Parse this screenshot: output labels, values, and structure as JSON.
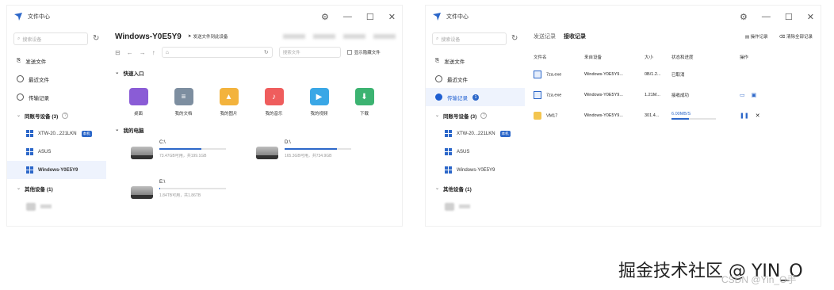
{
  "window1": {
    "title": "文件中心",
    "search_placeholder": "搜索设备",
    "nav": [
      {
        "label": "发送文件"
      },
      {
        "label": "最近文件"
      },
      {
        "label": "传输记录"
      }
    ],
    "group_same": {
      "label": "同账号设备 (3)"
    },
    "devices": [
      {
        "label": "XTW-20...221LKN",
        "tag": "本机"
      },
      {
        "label": "ASUS"
      },
      {
        "label": "Windows-Y0E5Y9"
      }
    ],
    "group_other": {
      "label": "其他设备 (1)"
    },
    "main": {
      "title": "Windows-Y0E5Y9",
      "send_btn": "发送文件到此设备",
      "path": "⌂",
      "search_files": "搜索文件",
      "show_hidden": "显示隐藏文件",
      "quick_title": "快速入口",
      "quick": [
        {
          "label": "桌面",
          "color": "#8a5cd6"
        },
        {
          "label": "我的文档",
          "color": "#7d8ea0"
        },
        {
          "label": "我的图片",
          "color": "#f3b33d"
        },
        {
          "label": "我的音乐",
          "color": "#ef5d5d"
        },
        {
          "label": "我的视频",
          "color": "#3aa7e6"
        },
        {
          "label": "下载",
          "color": "#3cb371"
        }
      ],
      "pc_title": "我的电脑",
      "drives": [
        {
          "name": "C:\\",
          "size": "73.47GB可用，共199.1GB",
          "used": 0.63
        },
        {
          "name": "D:\\",
          "size": "165.3GB可用，共734.9GB",
          "used": 0.78
        },
        {
          "name": "E:\\",
          "size": "1.84TB可用，共1.86TB",
          "used": 0.01
        }
      ]
    }
  },
  "window2": {
    "title": "文件中心",
    "search_placeholder": "搜索设备",
    "nav": [
      {
        "label": "发送文件"
      },
      {
        "label": "最近文件"
      },
      {
        "label": "传输记录",
        "badge": "1"
      }
    ],
    "group_same": {
      "label": "同账号设备 (3)"
    },
    "devices": [
      {
        "label": "XTW-20...221LKN",
        "tag": "本机"
      },
      {
        "label": "ASUS"
      },
      {
        "label": "Windows-Y0E5Y9"
      }
    ],
    "group_other": {
      "label": "其他设备 (1)"
    },
    "tabs": [
      "发送记录",
      "接收记录"
    ],
    "actions": [
      "操作记录",
      "清除全部记录"
    ],
    "headers": [
      "文件名",
      "来自设备",
      "大小",
      "状态和进度",
      "操作"
    ],
    "rows": [
      {
        "name": "7za.exe",
        "from": "Windows-Y0E5Y9...",
        "size": "0B/1.2...",
        "status": "已取消"
      },
      {
        "name": "7za.exe",
        "from": "Windows-Y0E5Y9...",
        "size": "1.21M...",
        "status": "接收成功"
      },
      {
        "name": "VM17",
        "from": "Windows-Y0E5Y9...",
        "size": "301.4...",
        "status": "6.00MB/S",
        "progress": 0.4
      }
    ]
  },
  "watermark": {
    "text": "掘金技术社区 @ YIN_O",
    "sub": "CSDN @Yin_O手"
  }
}
